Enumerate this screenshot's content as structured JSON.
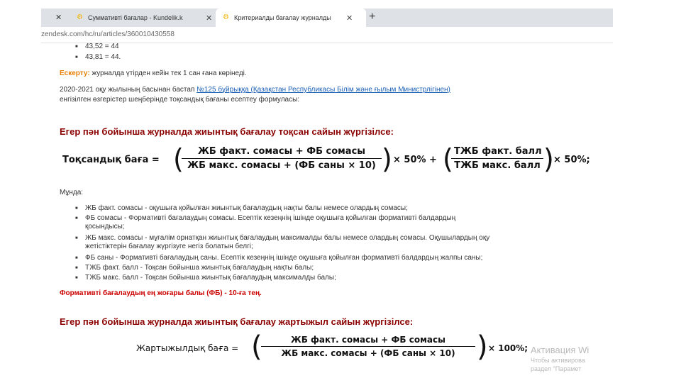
{
  "browser": {
    "tabs": [
      {
        "title": "Суммативті бағалар - Kundelik.k"
      },
      {
        "title": "Критериалды бағалау журналды"
      }
    ],
    "new_tab": "+",
    "url": "zendesk.com/hc/ru/articles/360010430558"
  },
  "article": {
    "top_items": [
      "43,52 = 44",
      "43,81 = 44."
    ],
    "note_label": "Ескерту:",
    "note_text": " журналда үтірден кейін тек 1 сан ғана көрінеді.",
    "para_before": "2020-2021 оқу жылының басынан бастап ",
    "para_link": "№125 бұйрыққа (Қазақстан Республикасы Білім және ғылым Министрлігінен)",
    "para_after": "енгізілген өзгерістер шеңберінде тоқсандық бағаны есептеу формуласы:",
    "heading_quarter": "Егер пән бойынша журналда жиынтық бағалау тоқсан сайын жүргізілсе:",
    "formula_quarter": {
      "lhs": "Тоқсандық баға =",
      "num1": "ЖБ факт. сомасы + ФБ сомасы",
      "den1": "ЖБ макс. сомасы + (ФБ саны × 10)",
      "mid": "× 50% +",
      "num2": "ТЖБ факт. балл",
      "den2": "ТЖБ макс. балл",
      "tail": "× 50%;"
    },
    "where_label": "Мұнда:",
    "definitions": [
      "ЖБ факт. сомасы - оқушыға қойылған жиынтық бағалаудың нақты балы немесе олардың сомасы;",
      "ФБ сомасы - Формативті бағалаудың сомасы. Есептік кезеңнің ішінде оқушыға қойылған формативті балдардың",
      "қосындысы;",
      "ЖБ макс. сомасы - мұғалім орнатқан жиынтық бағалаудың максималды балы немесе олардың сомасы. Оқушылардың оқу",
      "жетістіктерін бағалау жүргізуге негіз болатын белгі;",
      "ФБ саны - Формативті бағалаудың саны. Есептік кезеңнің ішінде оқушыға қойылған формативті балдардың жалпы саны;",
      "ТЖБ факт. балл - Тоқсан бойынша жиынтық бағалаудың нақты балы;",
      "ТЖБ макс. балл - Тоқсан бойынша жиынтық бағалаудың максималды балы;"
    ],
    "max_note": "Формативті бағалаудың ең жоғары балы (ФБ) - 10-ға тең.",
    "heading_half": "Егер пән бойынша журналда жиынтық бағалау жартыжыл сайын жүргізілсе:",
    "formula_half": {
      "lhs": "Жартыжылдық баға =",
      "num": "ЖБ факт. сомасы + ФБ сомасы",
      "den": "ЖБ макс. сомасы + (ФБ саны × 10)",
      "tail": "× 100%;"
    }
  },
  "overlay": {
    "activation_title": "Активация Wi",
    "activation_sub1": "Чтобы активирова",
    "activation_sub2": "раздел \"Парамет"
  }
}
